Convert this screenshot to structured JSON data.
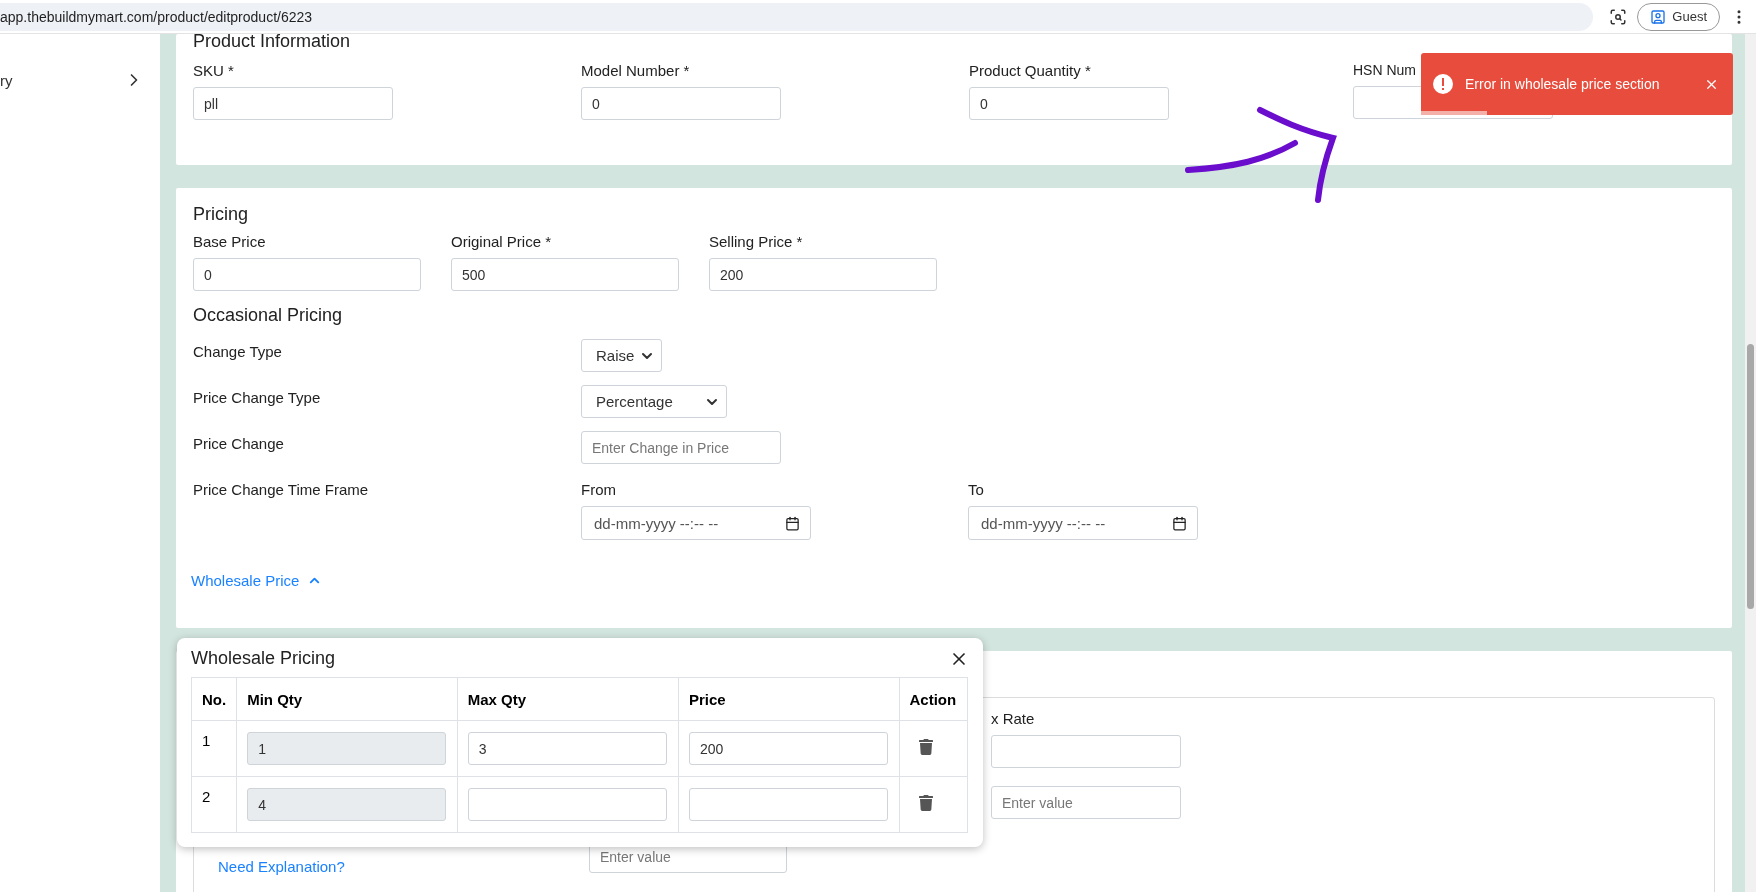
{
  "browser": {
    "url": "app.thebuildmymart.com/product/editproduct/6223",
    "profile": "Guest"
  },
  "sidebar": {
    "items": [
      {
        "label": "ry"
      }
    ]
  },
  "product_information": {
    "title": "Product Information",
    "fields": [
      {
        "label": "SKU *",
        "value": "pll"
      },
      {
        "label": "Model Number *",
        "value": "0"
      },
      {
        "label": "Product Quantity *",
        "value": "0"
      },
      {
        "label": "HSN Num"
      }
    ]
  },
  "pricing": {
    "title": "Pricing",
    "fields": [
      {
        "label": "Base Price",
        "value": "0"
      },
      {
        "label": "Original Price *",
        "value": "500"
      },
      {
        "label": "Selling Price *",
        "value": "200"
      }
    ]
  },
  "occasional_pricing": {
    "title": "Occasional Pricing",
    "rows": [
      {
        "kind": "select",
        "label": "Change Type",
        "value": "Raise"
      },
      {
        "kind": "select",
        "label": "Price Change Type",
        "value": "Percentage"
      },
      {
        "kind": "input",
        "label": "Price Change",
        "placeholder": "Enter Change in Price"
      },
      {
        "kind": "timeframe",
        "label": "Price Change Time Frame",
        "ranges": [
          {
            "label": "From",
            "placeholder": "dd-mm-yyyy --:-- --"
          },
          {
            "label": "To",
            "placeholder": "dd-mm-yyyy --:-- --"
          }
        ]
      }
    ]
  },
  "wholesale_toggle": {
    "label": "Wholesale Price",
    "expanded": true
  },
  "tax_section": {
    "rate_label": "x Rate",
    "value_placeholder": "Enter value",
    "extra_placeholder": "Enter value",
    "link": "Need Explanation?"
  },
  "wholesale_dialog": {
    "title": "Wholesale Pricing",
    "columns": [
      "No.",
      "Min Qty",
      "Max Qty",
      "Price",
      "Action"
    ],
    "rows": [
      {
        "no": "1",
        "min_qty": {
          "value": "1",
          "disabled": true
        },
        "max_qty": "3",
        "price": "200"
      },
      {
        "no": "2",
        "min_qty": {
          "value": "4",
          "disabled": true
        }
      }
    ]
  },
  "toast": {
    "kind": "error",
    "message": "Error in wholesale price section"
  }
}
